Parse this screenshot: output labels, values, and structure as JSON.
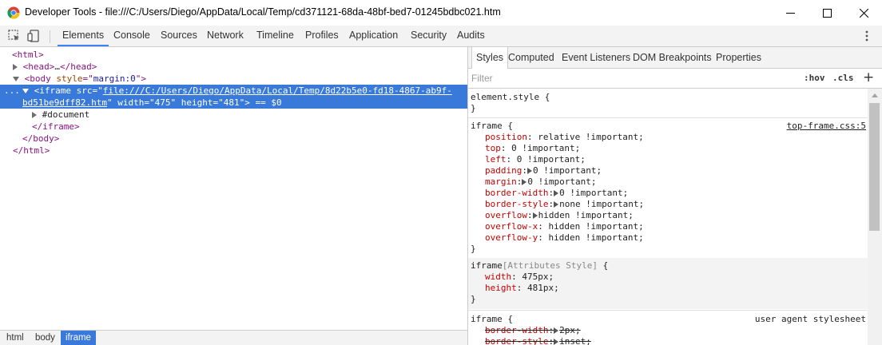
{
  "window": {
    "title": "Developer Tools - file:///C:/Users/Diego/AppData/Local/Temp/cd371121-68da-48bf-bed7-01245bdbc021.htm",
    "app_icon": "chrome-icon"
  },
  "toolbar": {
    "tabs": [
      "Elements",
      "Console",
      "Sources",
      "Network",
      "Timeline",
      "Profiles",
      "Application",
      "Security",
      "Audits"
    ],
    "selected_tab": "Elements"
  },
  "dom": {
    "line1": "<html>",
    "line2_tag": "<head>",
    "line2_ellipsis": "…",
    "line2_close": "</head>",
    "line3_open": "<body",
    "line3_attr": "style",
    "line3_val": "margin:0",
    "line3_close": ">",
    "sel_ellipsis": "...",
    "sel_tag": "<iframe",
    "sel_src_name": "src",
    "sel_src_val_part1": "file:///C:/Users/Diego/AppData/Local/Temp/8d22b5e0-fd18-4867-ab9f-",
    "sel_src_val_part2": "bd51be9dff82.htm",
    "sel_width_name": "width",
    "sel_width_val": "475",
    "sel_height_name": "height",
    "sel_height_val": "481",
    "sel_suffix": "> == $0",
    "doc_line": "#document",
    "iframe_close": "</iframe>",
    "body_close": "</body>",
    "html_close": "</html>"
  },
  "breadcrumbs": [
    "html",
    "body",
    "iframe"
  ],
  "styles_pane": {
    "tabs": [
      "Styles",
      "Computed",
      "Event Listeners",
      "DOM Breakpoints",
      "Properties"
    ],
    "selected_tab": "Styles",
    "filter_placeholder": "Filter",
    "hov": ":hov",
    "cls": ".cls",
    "plus": "+",
    "element_style": "element.style {",
    "close_brace": "}",
    "rule1": {
      "selector": "iframe {",
      "source": "top-frame.css:5",
      "props": [
        {
          "name": "position",
          "value": "relative !important;"
        },
        {
          "name": "top",
          "value": "0 !important;"
        },
        {
          "name": "left",
          "value": "0 !important;"
        },
        {
          "name": "padding",
          "value": "0 !important;"
        },
        {
          "name": "margin",
          "value": "0 !important;"
        },
        {
          "name": "border-width",
          "value": "0 !important;"
        },
        {
          "name": "border-style",
          "value": "none !important;"
        },
        {
          "name": "overflow",
          "value": "hidden !important;"
        },
        {
          "name": "overflow-x",
          "value": "hidden !important;"
        },
        {
          "name": "overflow-y",
          "value": "hidden !important;"
        }
      ]
    },
    "rule2": {
      "selector_main": "iframe",
      "selector_attr": "[Attributes Style]",
      "selector_brace": " {",
      "props": [
        {
          "name": "width",
          "value": "475px;"
        },
        {
          "name": "height",
          "value": "481px;"
        }
      ]
    },
    "rule3": {
      "selector": "iframe {",
      "source": "user agent stylesheet",
      "props": [
        {
          "name": "border-width",
          "value": "2px;"
        },
        {
          "name": "border-style",
          "value": "inset;"
        }
      ]
    }
  }
}
